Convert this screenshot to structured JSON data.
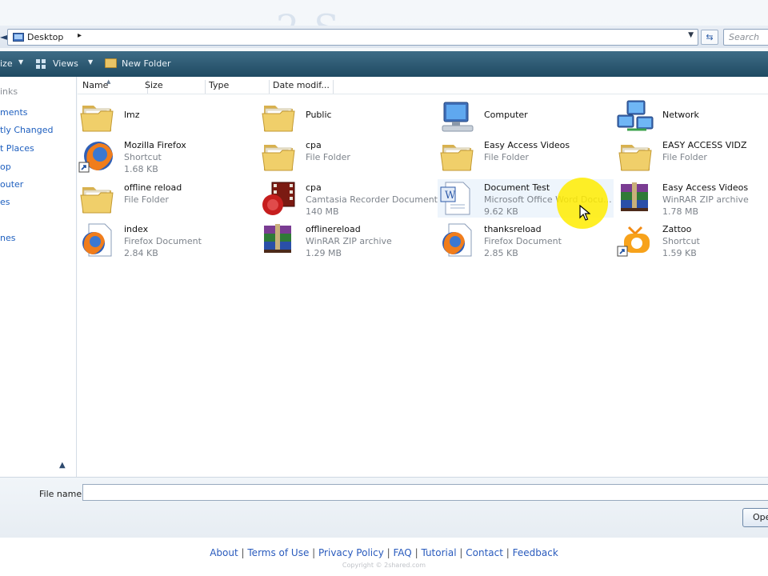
{
  "address": {
    "path": "Desktop",
    "separator": "▸"
  },
  "search": {
    "placeholder": "Search"
  },
  "toolbar": {
    "organize": "ize",
    "views": "Views",
    "new_folder": "New Folder"
  },
  "nav": {
    "items": [
      "inks",
      "ments",
      "tly Changed",
      "t Places",
      "op",
      "outer",
      "es",
      "",
      "nes",
      ""
    ]
  },
  "columns": [
    "Name",
    "Size",
    "Type",
    "Date modif..."
  ],
  "files": [
    {
      "name": "lmz",
      "type": "",
      "size": "",
      "icon": "folder-icon"
    },
    {
      "name": "Public",
      "type": "",
      "size": "",
      "icon": "folder-icon"
    },
    {
      "name": "Computer",
      "type": "",
      "size": "",
      "icon": "computer-icon"
    },
    {
      "name": "Network",
      "type": "",
      "size": "",
      "icon": "network-icon"
    },
    {
      "name": "Mozilla Firefox",
      "type": "Shortcut",
      "size": "1.68 KB",
      "icon": "firefox-shortcut-icon"
    },
    {
      "name": "cpa",
      "type": "File Folder",
      "size": "",
      "icon": "folder-icon"
    },
    {
      "name": "Easy Access Videos",
      "type": "File Folder",
      "size": "",
      "icon": "folder-icon"
    },
    {
      "name": "EASY ACCESS VIDZ",
      "type": "File Folder",
      "size": "",
      "icon": "folder-icon"
    },
    {
      "name": "offline reload",
      "type": "File Folder",
      "size": "",
      "icon": "folder-icon"
    },
    {
      "name": "cpa",
      "type": "Camtasia Recorder Document",
      "size": "140 MB",
      "icon": "camtasia-icon"
    },
    {
      "name": "Document Test",
      "type": "Microsoft Office Word Docu...",
      "size": "9.62 KB",
      "icon": "word-document-icon"
    },
    {
      "name": "Easy Access Videos",
      "type": "WinRAR ZIP archive",
      "size": "1.78 MB",
      "icon": "winrar-icon"
    },
    {
      "name": "index",
      "type": "Firefox Document",
      "size": "2.84 KB",
      "icon": "firefox-document-icon"
    },
    {
      "name": "offlinereload",
      "type": "WinRAR ZIP archive",
      "size": "1.29 MB",
      "icon": "winrar-icon"
    },
    {
      "name": "thanksreload",
      "type": "Firefox Document",
      "size": "2.85 KB",
      "icon": "firefox-document-icon"
    },
    {
      "name": "Zattoo",
      "type": "Shortcut",
      "size": "1.59 KB",
      "icon": "zattoo-shortcut-icon"
    }
  ],
  "filename": {
    "label": "File name:",
    "value": ""
  },
  "buttons": {
    "open": "Ope"
  },
  "footer": {
    "links": [
      "About",
      "Terms of Use",
      "Privacy Policy",
      "FAQ",
      "Tutorial",
      "Contact",
      "Feedback"
    ],
    "copyright": "Copyright © 2shared.com"
  },
  "colors": {
    "toolbar": "#2b5670",
    "link": "#1e5fbf",
    "accent_cursor": "#ffec00"
  }
}
